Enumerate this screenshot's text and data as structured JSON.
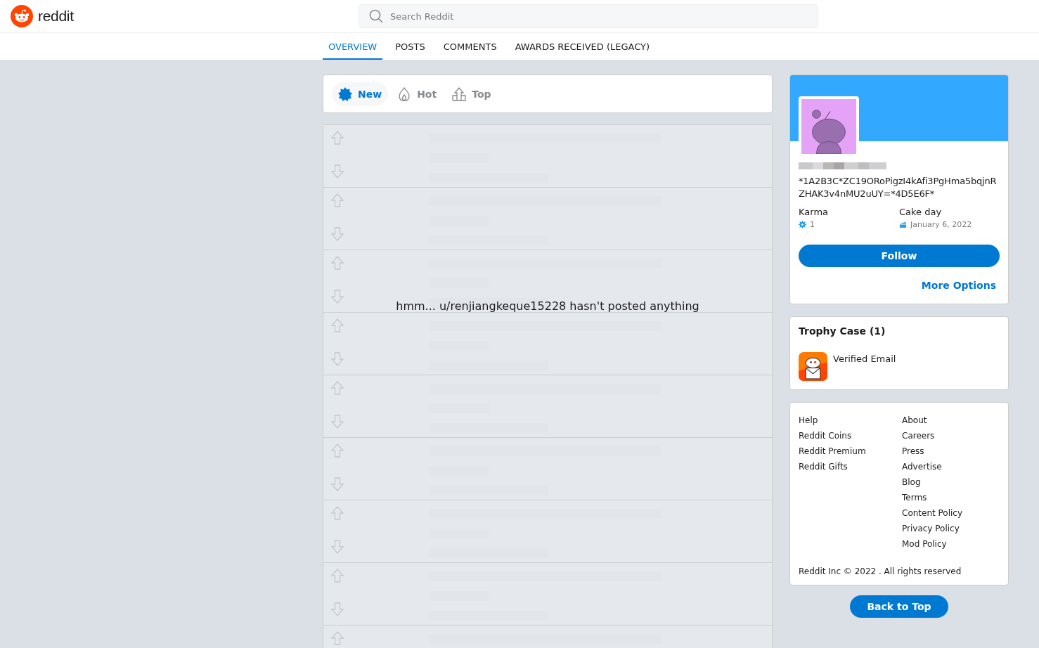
{
  "header": {
    "logo_text": "reddit",
    "search": {
      "placeholder": "Search Reddit"
    }
  },
  "tabs": [
    {
      "label": "OVERVIEW",
      "selected": true
    },
    {
      "label": "POSTS",
      "selected": false
    },
    {
      "label": "COMMENTS",
      "selected": false
    },
    {
      "label": "AWARDS RECEIVED (LEGACY)",
      "selected": false
    }
  ],
  "sort": [
    {
      "label": "New",
      "kind": "new",
      "selected": true
    },
    {
      "label": "Hot",
      "kind": "hot",
      "selected": false
    },
    {
      "label": "Top",
      "kind": "top",
      "selected": false
    }
  ],
  "feed": {
    "empty_message": "hmm... u/renjiangkeque15228 hasn't posted anything",
    "rows": [
      {
        "kind": "placeholder"
      },
      {
        "kind": "placeholder"
      },
      {
        "kind": "placeholder"
      },
      {
        "kind": "placeholder"
      },
      {
        "kind": "placeholder"
      },
      {
        "kind": "placeholder"
      },
      {
        "kind": "placeholder"
      },
      {
        "kind": "placeholder"
      },
      {
        "kind": "cut_placeholder"
      }
    ]
  },
  "profile": {
    "bio": "*1A2B3C*ZC19ORoPigzI4kAfi3PgHma5bqjnRZHAK3v4nMU2uUY=*4D5E6F*",
    "karma_label": "Karma",
    "karma": "1",
    "cake_label": "Cake day",
    "cake_day": "January 6, 2022",
    "follow_button": "Follow",
    "more_options": "More Options"
  },
  "trophy_case": {
    "title": "Trophy Case (1)",
    "trophies": [
      {
        "name": "Verified Email"
      }
    ]
  },
  "footer_links": {
    "column_1": [
      "Help",
      "Reddit Coins",
      "Reddit Premium",
      "Reddit Gifts"
    ],
    "column_2": [
      "About",
      "Careers",
      "Press",
      "Advertise",
      "Blog",
      "Terms",
      "Content Policy",
      "Privacy Policy",
      "Mod Policy"
    ],
    "copyright": "Reddit Inc © 2022 . All rights reserved"
  },
  "back_to_top": "Back to Top"
}
